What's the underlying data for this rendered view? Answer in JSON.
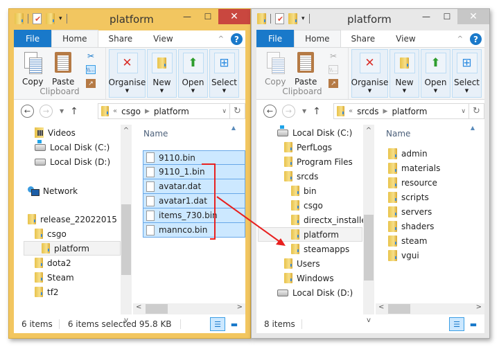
{
  "left_window": {
    "title": "platform",
    "tabs": [
      "File",
      "Home",
      "Share",
      "View"
    ],
    "ribbon": {
      "copy": "Copy",
      "paste": "Paste",
      "clipboard_group": "Clipboard",
      "organise": "Organise",
      "new": "New",
      "open": "Open",
      "select": "Select"
    },
    "address": {
      "overflow": "«",
      "crumbs": [
        "csgo",
        "platform"
      ]
    },
    "tree": [
      {
        "label": "Videos",
        "icon": "videos-icon"
      },
      {
        "label": "Local Disk (C:)",
        "icon": "drive-c-icon"
      },
      {
        "label": "Local Disk (D:)",
        "icon": "drive-icon"
      },
      {
        "label": "Network",
        "icon": "network-icon"
      },
      {
        "label": "release_22022015",
        "icon": "folder-icon"
      },
      {
        "label": "csgo",
        "icon": "folder-icon"
      },
      {
        "label": "platform",
        "icon": "folder-icon",
        "selected": true
      },
      {
        "label": "dota2",
        "icon": "folder-icon"
      },
      {
        "label": "Steam",
        "icon": "folder-icon"
      },
      {
        "label": "tf2",
        "icon": "folder-icon"
      }
    ],
    "column_name": "Name",
    "files": [
      "9110.bin",
      "9110_1.bin",
      "avatar.dat",
      "avatar1.dat",
      "items_730.bin",
      "mannco.bin"
    ],
    "status": {
      "items": "6 items",
      "selected": "6 items selected  95.8 KB"
    }
  },
  "right_window": {
    "title": "platform",
    "tabs": [
      "File",
      "Home",
      "Share",
      "View"
    ],
    "ribbon": {
      "copy": "Copy",
      "paste": "Paste",
      "clipboard_group": "Clipboard",
      "organise": "Organise",
      "new": "New",
      "open": "Open",
      "select": "Select"
    },
    "address": {
      "overflow": "«",
      "crumbs": [
        "srcds",
        "platform"
      ]
    },
    "tree": [
      {
        "label": "Local Disk (C:)",
        "icon": "drive-c-icon"
      },
      {
        "label": "PerfLogs",
        "icon": "folder-icon"
      },
      {
        "label": "Program Files",
        "icon": "folder-icon"
      },
      {
        "label": "srcds",
        "icon": "folder-icon"
      },
      {
        "label": "bin",
        "icon": "folder-icon"
      },
      {
        "label": "csgo",
        "icon": "folder-icon"
      },
      {
        "label": "directx_installer",
        "icon": "folder-icon"
      },
      {
        "label": "platform",
        "icon": "folder-icon",
        "selected": true
      },
      {
        "label": "steamapps",
        "icon": "folder-icon"
      },
      {
        "label": "Users",
        "icon": "folder-icon"
      },
      {
        "label": "Windows",
        "icon": "folder-icon"
      },
      {
        "label": "Local Disk (D:)",
        "icon": "drive-icon"
      }
    ],
    "column_name": "Name",
    "folders": [
      "admin",
      "materials",
      "resource",
      "scripts",
      "servers",
      "shaders",
      "steam",
      "vgui"
    ],
    "status": {
      "items": "8 items"
    }
  },
  "annotation": {
    "color": "#e8201f",
    "meaning": "drag selected files to platform folder"
  }
}
